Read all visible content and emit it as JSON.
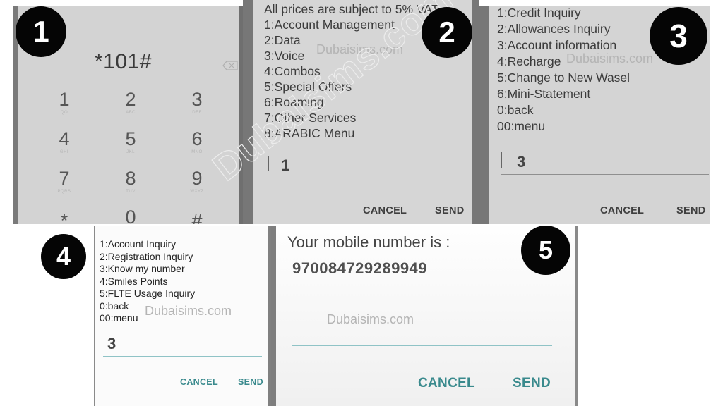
{
  "watermark": "Dubaisims.com",
  "badges": [
    "1",
    "2",
    "3",
    "4",
    "5"
  ],
  "step1": {
    "dial_input": "*101#",
    "backspace_icon": "backspace-icon",
    "keys": [
      {
        "digit": "1",
        "letters": "QO"
      },
      {
        "digit": "2",
        "letters": "ABC"
      },
      {
        "digit": "3",
        "letters": "DEF"
      },
      {
        "digit": "4",
        "letters": "GHI"
      },
      {
        "digit": "5",
        "letters": "JKL"
      },
      {
        "digit": "6",
        "letters": "MNO"
      },
      {
        "digit": "7",
        "letters": "PQRS"
      },
      {
        "digit": "8",
        "letters": "TUV"
      },
      {
        "digit": "9",
        "letters": "WXYZ"
      },
      {
        "digit": "*",
        "letters": ""
      },
      {
        "digit": "0",
        "letters": ""
      },
      {
        "digit": "#",
        "letters": ""
      }
    ]
  },
  "step2": {
    "lines": [
      "All prices are subject to 5% VAT",
      "1:Account Management",
      "2:Data",
      "3:Voice",
      "4:Combos",
      "5:Special Offers",
      "6:Roaming",
      "7:Other Services",
      "8:ARABIC Menu"
    ],
    "input_value": "1",
    "cancel_label": "CANCEL",
    "send_label": "SEND"
  },
  "step3": {
    "lines": [
      "1:Credit Inquiry",
      "2:Allowances Inquiry",
      "3:Account information",
      "4:Recharge",
      "5:Change to New Wasel",
      "6:Mini-Statement",
      "0:back",
      "00:menu"
    ],
    "input_value": "3",
    "cancel_label": "CANCEL",
    "send_label": "SEND"
  },
  "step4": {
    "lines": [
      "1:Account Inquiry",
      "2:Registration Inquiry",
      "3:Know my number",
      "4:Smiles Points",
      "5:FLTE Usage Inquiry",
      "0:back",
      "00:menu"
    ],
    "input_value": "3",
    "cancel_label": "CANCEL",
    "send_label": "SEND"
  },
  "step5": {
    "message": "Your mobile number is :",
    "number": "970084729289949",
    "input_value": "",
    "cancel_label": "CANCEL",
    "send_label": "SEND"
  },
  "colors": {
    "accent_teal": "#3a8a8d",
    "badge": "#050505"
  }
}
